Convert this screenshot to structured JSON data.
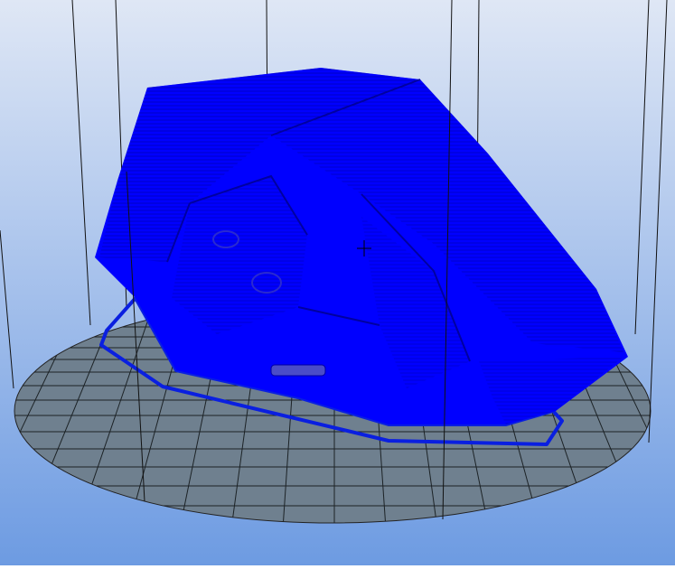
{
  "viewport": {
    "background_top": "#dfe7f5",
    "background_bottom": "#6d9be2",
    "bed_color": "#6f808f",
    "grid_color": "#1c2226",
    "model_color": "#0000ff",
    "model_shadow": "#0000c8",
    "skirt_color": "#0a1fe0",
    "build_volume_color": "#111111"
  }
}
